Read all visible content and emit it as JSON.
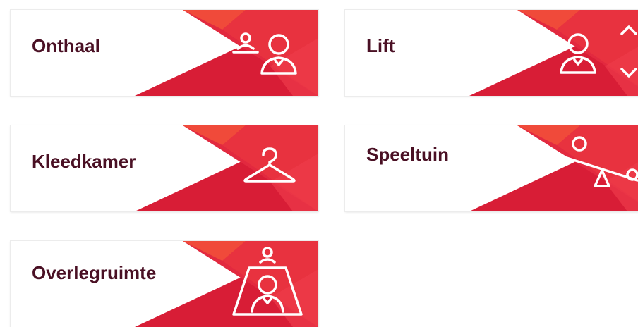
{
  "colors": {
    "label_text": "#4a1024",
    "red_dark": "#d81d36",
    "red_mid": "#e2293f",
    "red_light": "#ec3c49",
    "orange": "#f04a3a",
    "icon_stroke": "#ffffff"
  },
  "tiles": [
    {
      "label": "Onthaal",
      "icon": "reception-desk-icon"
    },
    {
      "label": "Lift",
      "icon": "elevator-icon"
    },
    {
      "label": "Kleedkamer",
      "icon": "coat-hanger-icon"
    },
    {
      "label": "Speeltuin",
      "icon": "seesaw-icon"
    },
    {
      "label": "Overlegruimte",
      "icon": "meeting-room-icon"
    }
  ]
}
